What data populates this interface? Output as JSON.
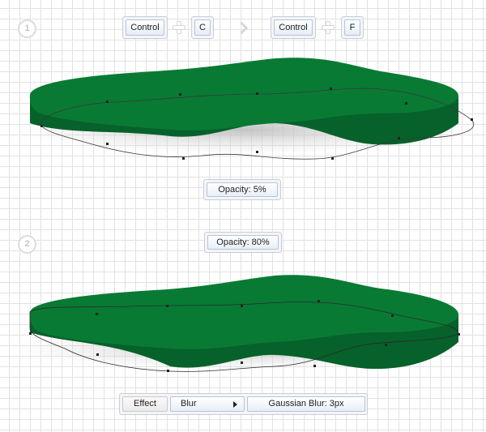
{
  "steps": {
    "one": "1",
    "two": "2"
  },
  "shortcut_copy": {
    "modifier": "Control",
    "key": "C"
  },
  "shortcut_paste_front": {
    "modifier": "Control",
    "key": "F"
  },
  "panel_opacity_1": "Opacity: 5%",
  "panel_opacity_2": "Opacity: 80%",
  "effect": {
    "label": "Effect",
    "menu": "Blur",
    "submenu": "Gaussian Blur: 3px"
  },
  "colors": {
    "shape_top": "#087a34",
    "shape_side": "#06612a",
    "grid": "#e2e2e2"
  },
  "icons": {
    "plus": "plus-icon",
    "arrow": "chevron-right-icon"
  }
}
